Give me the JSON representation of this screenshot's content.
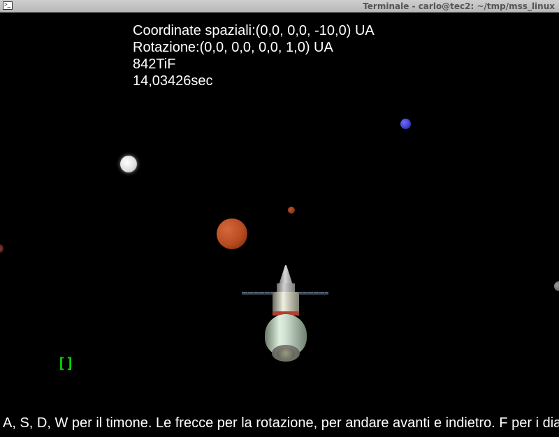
{
  "window": {
    "title": "Terminale - carlo@tec2: ~/tmp/mss_linux"
  },
  "hud": {
    "coord_label": "Coordinate spaziali:",
    "coord_value": "(0,0, 0,0, -10,0) UA",
    "rot_label": "Rotazione:",
    "rot_value": "(0,0, 0,0, 0,0, 1,0) UA",
    "frame": "842TiF",
    "time": "14,03426sec"
  },
  "bracket": "[]",
  "help": "A, S, D, W per il timone. Le frecce per la rotazione, per andare avanti e indietro. F per i dia",
  "colors": {
    "text": "#ffffff",
    "bracket": "#00e000",
    "bg": "#000000"
  }
}
